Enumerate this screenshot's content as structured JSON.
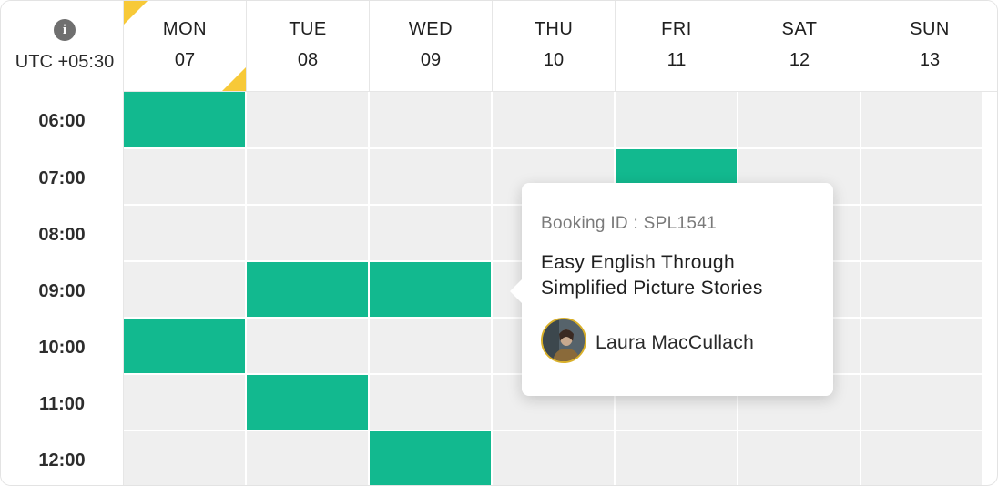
{
  "timezone": {
    "label": "UTC +05:30",
    "info_icon": "info-icon"
  },
  "days": [
    {
      "name": "MON",
      "date": "07",
      "selected": true
    },
    {
      "name": "TUE",
      "date": "08",
      "selected": false
    },
    {
      "name": "WED",
      "date": "09",
      "selected": false
    },
    {
      "name": "THU",
      "date": "10",
      "selected": false
    },
    {
      "name": "FRI",
      "date": "11",
      "selected": false
    },
    {
      "name": "SAT",
      "date": "12",
      "selected": false
    },
    {
      "name": "SUN",
      "date": "13",
      "selected": false
    }
  ],
  "times": [
    "06:00",
    "07:00",
    "08:00",
    "09:00",
    "10:00",
    "11:00",
    "12:00"
  ],
  "booked_slots": [
    {
      "day": "MON",
      "time": "06:00"
    },
    {
      "day": "FRI",
      "time": "07:00"
    },
    {
      "day": "TUE",
      "time": "09:00"
    },
    {
      "day": "WED",
      "time": "09:00"
    },
    {
      "day": "MON",
      "time": "10:00"
    },
    {
      "day": "TUE",
      "time": "11:00"
    },
    {
      "day": "WED",
      "time": "12:00"
    }
  ],
  "tooltip": {
    "booking_id": "Booking ID : SPL1541",
    "title": "Easy English Through Simplified Picture Stories",
    "teacher_name": "Laura MacCullach"
  },
  "colors": {
    "booked": "#12b98f",
    "empty": "#efefef",
    "selected_marker": "#f7c938"
  }
}
